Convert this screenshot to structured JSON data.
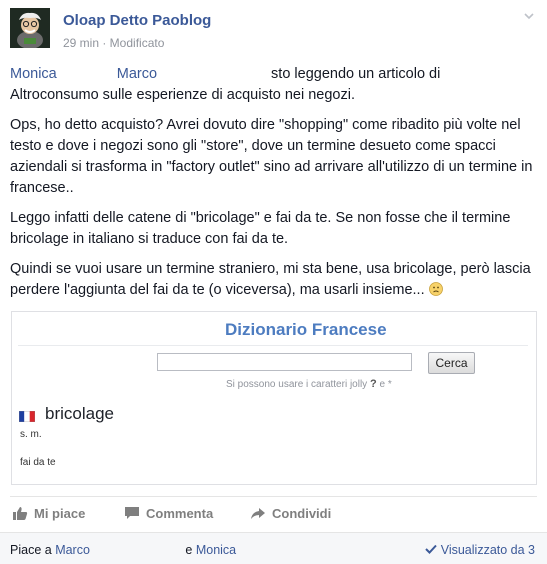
{
  "header": {
    "author": "Oloap Detto Paoblog",
    "meta": "29 min · Modificato"
  },
  "post": {
    "mention_1": "Monica",
    "mention_2": "Marco",
    "line_1_rest": "sto leggendo un articolo di",
    "line_1_cont": "Altroconsumo sulle esperienze di acquisto nei negozi.",
    "p2": "Ops, ho detto acquisto? Avrei dovuto dire \"shopping\" come ribadito più volte nel testo e dove i negozi sono gli \"store\", dove un termine desueto come spacci aziendali si trasforma in \"factory outlet\" sino ad arrivare all'utilizzo di un termine in francese..",
    "p3": "Leggo infatti delle catene di \"bricolage\" e fai da te. Se non fosse che il termine bricolage in italiano si traduce con fai da te.",
    "p4": "Quindi se vuoi usare un termine straniero, mi sta bene, usa bricolage, però lascia perdere l'aggiunta del fai da te (o viceversa), ma usarli insieme..."
  },
  "card": {
    "title": "Dizionario Francese",
    "search_button": "Cerca",
    "hint_text": "Si possono usare i caratteri jolly",
    "hint_wild_1": "?",
    "hint_e": "e",
    "hint_wild_2": "*",
    "entry_word": "bricolage",
    "entry_pos": "s. m.",
    "entry_def": "fai da te"
  },
  "actions": {
    "like": "Mi piace",
    "comment": "Commenta",
    "share": "Condividi"
  },
  "footer": {
    "likes_prefix": "Piace a",
    "liker_1": "Marco",
    "and": "e",
    "liker_2": "Monica",
    "seen": "Visualizzato da 3"
  },
  "icons": {
    "avatar": "cartoon-avatar",
    "chevron": "chevron-down-icon",
    "emoji": "frown-emoji-icon",
    "flag": "french-flag-icon",
    "like": "thumb-up-icon",
    "comment": "speech-bubble-icon",
    "share": "share-arrow-icon",
    "seen": "check-icon"
  },
  "colors": {
    "link": "#3b5998",
    "card_title": "#4d7cc0",
    "meta": "#90949c",
    "action": "#7f7f7f"
  }
}
